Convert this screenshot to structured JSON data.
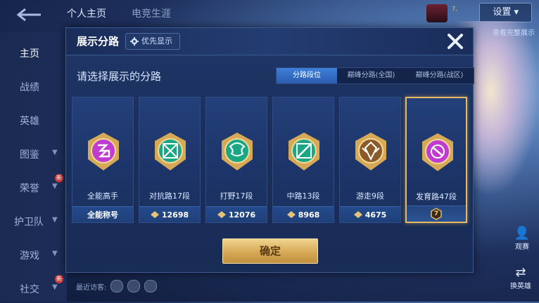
{
  "background": {
    "tabs": [
      "个人主页",
      "电竞生涯"
    ],
    "settings_label": "设置",
    "top_stats": "7,",
    "nav_items": [
      {
        "label": "主页",
        "active": true,
        "chevron": false,
        "badge": ""
      },
      {
        "label": "战绩",
        "active": false,
        "chevron": false,
        "badge": ""
      },
      {
        "label": "英雄",
        "active": false,
        "chevron": false,
        "badge": ""
      },
      {
        "label": "图鉴",
        "active": false,
        "chevron": true,
        "badge": ""
      },
      {
        "label": "荣誉",
        "active": false,
        "chevron": true,
        "badge": "新"
      },
      {
        "label": "护卫队",
        "active": false,
        "chevron": true,
        "badge": ""
      },
      {
        "label": "游戏",
        "active": false,
        "chevron": true,
        "badge": ""
      },
      {
        "label": "社交",
        "active": false,
        "chevron": true,
        "badge": "新"
      }
    ],
    "side_button_top": "查看完整展示",
    "side_button_mid": "观赛",
    "side_button_bottom": "换英雄",
    "visitors_label": "最近访客:"
  },
  "modal": {
    "title": "展示分路",
    "priority_button": "优先显示",
    "subtitle": "请选择展示的分路",
    "segments": [
      {
        "label": "分路段位",
        "selected": true
      },
      {
        "label": "巅峰分路(全国)",
        "selected": false
      },
      {
        "label": "巅峰分路(战区)",
        "selected": false
      }
    ],
    "cards": [
      {
        "name": "全能高手",
        "footer": "全能称号",
        "show_score_icon": false,
        "emblem_color": "#c03bd0",
        "emblem_icon": "all-round-icon",
        "selected": false
      },
      {
        "name": "对抗路17段",
        "footer": "12698",
        "show_score_icon": true,
        "emblem_color": "#1aa884",
        "emblem_icon": "clash-lane-icon",
        "selected": false
      },
      {
        "name": "打野17段",
        "footer": "12076",
        "show_score_icon": true,
        "emblem_color": "#1aa884",
        "emblem_icon": "jungle-dragon-icon",
        "selected": false
      },
      {
        "name": "中路13段",
        "footer": "8968",
        "show_score_icon": true,
        "emblem_color": "#1aa884",
        "emblem_icon": "mid-lane-icon",
        "selected": false
      },
      {
        "name": "游走9段",
        "footer": "4675",
        "show_score_icon": true,
        "emblem_color": "#8a5a2a",
        "emblem_icon": "roam-icon",
        "selected": false
      },
      {
        "name": "发育路47段",
        "footer": "7",
        "show_score_icon": false,
        "emblem_color": "#c03bd0",
        "emblem_icon": "farm-lane-icon",
        "selected": true
      }
    ],
    "confirm_label": "确定"
  },
  "colors": {
    "accent_gold": "#e6b965",
    "selected_segment": "#3d7fd9",
    "emblem_purple": "#c03bd0",
    "emblem_teal": "#1aa884"
  }
}
